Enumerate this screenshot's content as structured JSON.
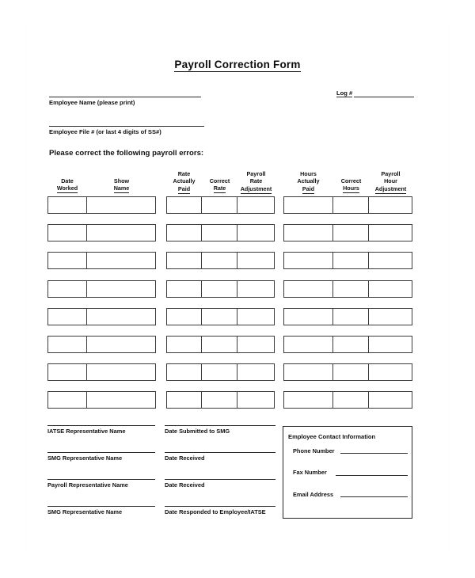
{
  "document": {
    "title": "Payroll Correction Form",
    "instruction": "Please correct the following payroll errors:"
  },
  "identity": {
    "employee_name_label": "Employee Name (please print)",
    "employee_file_label": "Employee File # (or last 4 digits of SS#)",
    "log_label": "Log #",
    "employee_name_value": "",
    "employee_file_value": "",
    "log_value": ""
  },
  "table": {
    "groups": [
      {
        "name": "date-show-group",
        "columns": [
          {
            "lines": [
              "Date"
            ],
            "underlined": "Worked"
          },
          {
            "lines": [
              "Show"
            ],
            "underlined": "Name"
          }
        ]
      },
      {
        "name": "rate-group",
        "columns": [
          {
            "lines": [
              "Rate",
              "Actually"
            ],
            "underlined": "Paid"
          },
          {
            "lines": [
              "Correct"
            ],
            "underlined": "Rate"
          },
          {
            "lines": [
              "Payroll",
              "Rate"
            ],
            "underlined": "Adjustment"
          }
        ]
      },
      {
        "name": "hours-group",
        "columns": [
          {
            "lines": [
              "Hours",
              "Actually"
            ],
            "underlined": "Paid"
          },
          {
            "lines": [
              "Correct"
            ],
            "underlined": "Hours"
          },
          {
            "lines": [
              "Payroll",
              "Hour"
            ],
            "underlined": "Adjustment"
          }
        ]
      }
    ],
    "row_count": 8,
    "rows": [
      {
        "date_worked": "",
        "show_name": "",
        "rate_actually_paid": "",
        "correct_rate": "",
        "payroll_rate_adjustment": "",
        "hours_actually_paid": "",
        "correct_hours": "",
        "payroll_hour_adjustment": ""
      },
      {
        "date_worked": "",
        "show_name": "",
        "rate_actually_paid": "",
        "correct_rate": "",
        "payroll_rate_adjustment": "",
        "hours_actually_paid": "",
        "correct_hours": "",
        "payroll_hour_adjustment": ""
      },
      {
        "date_worked": "",
        "show_name": "",
        "rate_actually_paid": "",
        "correct_rate": "",
        "payroll_rate_adjustment": "",
        "hours_actually_paid": "",
        "correct_hours": "",
        "payroll_hour_adjustment": ""
      },
      {
        "date_worked": "",
        "show_name": "",
        "rate_actually_paid": "",
        "correct_rate": "",
        "payroll_rate_adjustment": "",
        "hours_actually_paid": "",
        "correct_hours": "",
        "payroll_hour_adjustment": ""
      },
      {
        "date_worked": "",
        "show_name": "",
        "rate_actually_paid": "",
        "correct_rate": "",
        "payroll_rate_adjustment": "",
        "hours_actually_paid": "",
        "correct_hours": "",
        "payroll_hour_adjustment": ""
      },
      {
        "date_worked": "",
        "show_name": "",
        "rate_actually_paid": "",
        "correct_rate": "",
        "payroll_rate_adjustment": "",
        "hours_actually_paid": "",
        "correct_hours": "",
        "payroll_hour_adjustment": ""
      },
      {
        "date_worked": "",
        "show_name": "",
        "rate_actually_paid": "",
        "correct_rate": "",
        "payroll_rate_adjustment": "",
        "hours_actually_paid": "",
        "correct_hours": "",
        "payroll_hour_adjustment": ""
      },
      {
        "date_worked": "",
        "show_name": "",
        "rate_actually_paid": "",
        "correct_rate": "",
        "payroll_rate_adjustment": "",
        "hours_actually_paid": "",
        "correct_hours": "",
        "payroll_hour_adjustment": ""
      }
    ]
  },
  "signatures": {
    "left": [
      {
        "label": "IATSE Representative Name",
        "value": ""
      },
      {
        "label": "SMG Representative Name",
        "value": ""
      },
      {
        "label": "Payroll Representative Name",
        "value": ""
      },
      {
        "label": "SMG Representative Name",
        "value": ""
      }
    ],
    "right": [
      {
        "label": "Date Submitted to SMG",
        "value": ""
      },
      {
        "label": "Date Received",
        "value": ""
      },
      {
        "label": "Date Received",
        "value": ""
      },
      {
        "label": "Date Responded to Employee/IATSE",
        "value": ""
      }
    ]
  },
  "contact": {
    "title": "Employee Contact Information",
    "fields": [
      {
        "label": "Phone Number",
        "value": ""
      },
      {
        "label": "Fax Number",
        "value": ""
      },
      {
        "label": "Email Address",
        "value": ""
      }
    ]
  },
  "colors": {
    "page_bg": "#ffffff",
    "ink": "#111111",
    "rule": "#2b2b2b",
    "box_border": "#3a3a3a"
  }
}
